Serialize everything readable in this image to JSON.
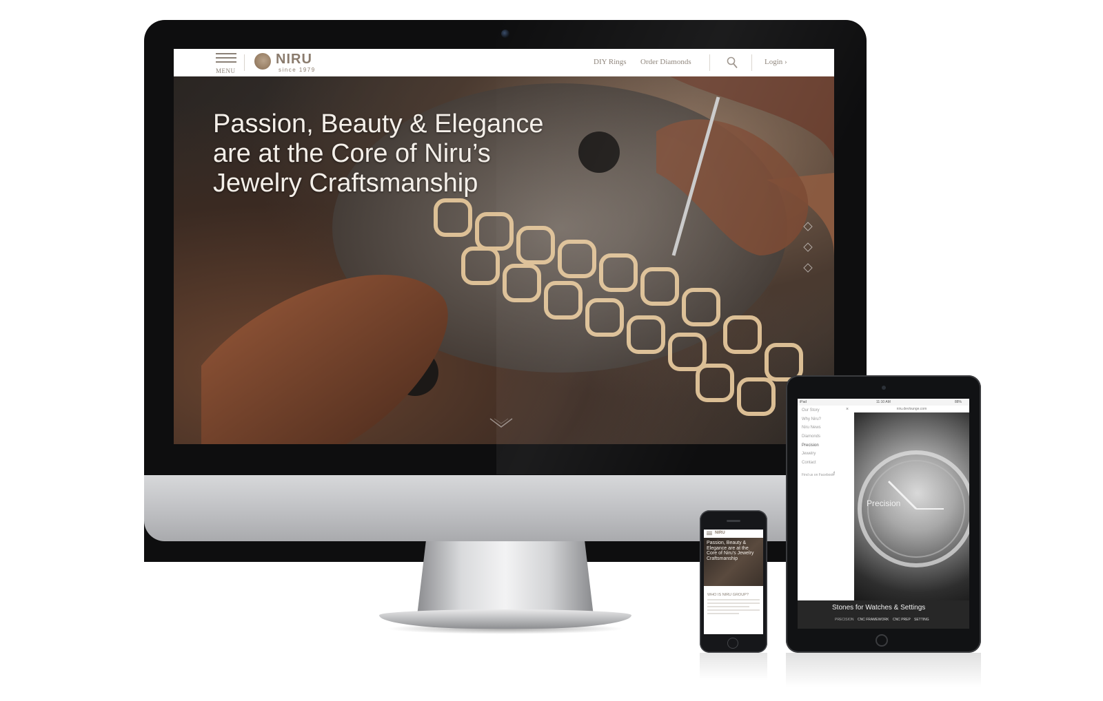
{
  "desktop": {
    "nav": {
      "menu_label": "MENU",
      "logo_text": "NIRU",
      "logo_tagline": "since 1979",
      "links": [
        "DIY Rings",
        "Order Diamonds"
      ],
      "login_label": "Login ›"
    },
    "hero": {
      "title_lines": [
        "Passion, Beauty & Elegance",
        "are at the Core of Niru’s",
        "Jewelry Craftsmanship"
      ]
    }
  },
  "tablet": {
    "status_left": "iPad",
    "status_center": "11:10 AM",
    "status_right": "88%",
    "url": "niru.devlounge.com",
    "close_icon_label": "×",
    "menu_items": [
      "Our Story",
      "Why Niru?",
      "Niru News",
      "Diamonds",
      "Precision",
      "Jewelry",
      "Contact"
    ],
    "facebook_label": "Find us on Facebook",
    "overlay_title": "Precision",
    "caption": "Stones for Watches & Settings",
    "tabs": [
      "PRECISION",
      "CNC FRAMEWORK",
      "CNC PREP",
      "SETTING"
    ]
  },
  "phone": {
    "logo_text": "NIRU",
    "hero_lines": [
      "Passion, Beauty &",
      "Elegance are at the",
      "Core of Niru’s Jewelry",
      "Craftsmanship"
    ],
    "section_title": "WHO IS NIRU GROUP?"
  },
  "colors": {
    "nav_text": "#8a8076",
    "logo": "#8a7b6d",
    "hero_text": "#f4efe9",
    "device_black": "#0e0e0f"
  }
}
